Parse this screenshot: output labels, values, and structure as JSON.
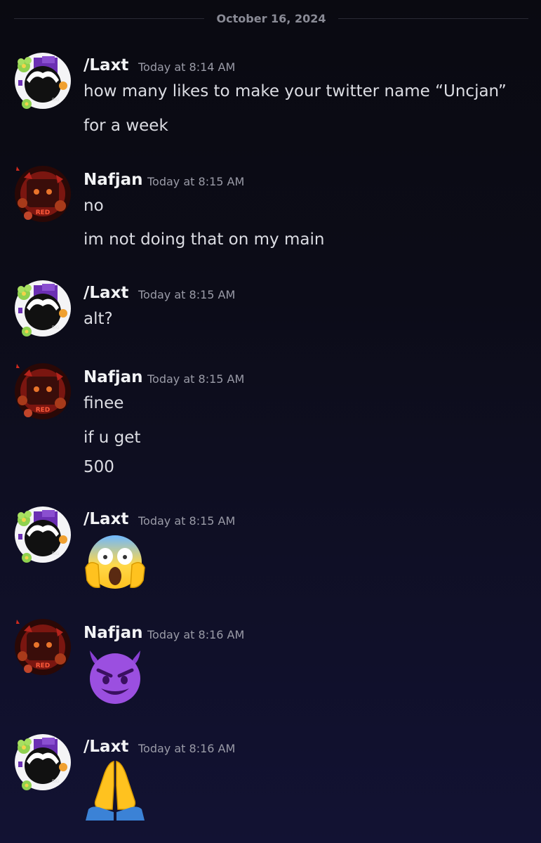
{
  "date_divider": "October 16, 2024",
  "messages": [
    {
      "author": "/Laxt",
      "time": "Today at 8:14 AM",
      "lines": [
        "how many likes to make your twitter name “Uncjan”",
        "for a week"
      ]
    },
    {
      "author": "Nafjan",
      "time": "Today at 8:15 AM",
      "lines": [
        "no",
        "im not doing that on my main"
      ]
    },
    {
      "author": "/Laxt",
      "time": "Today at 8:15 AM",
      "lines": [
        "alt?"
      ]
    },
    {
      "author": "Nafjan",
      "time": "Today at 8:15 AM",
      "lines": [
        "finee",
        "if u get",
        "500"
      ]
    },
    {
      "author": "/Laxt",
      "time": "Today at 8:15 AM",
      "emoji": "face-screaming-in-fear-emoji"
    },
    {
      "author": "Nafjan",
      "time": "Today at 8:16 AM",
      "emoji": "smiling-face-with-horns-emoji"
    },
    {
      "author": "/Laxt",
      "time": "Today at 8:16 AM",
      "emoji": "folded-hands-emoji"
    }
  ],
  "avatars": {
    "laxt": {
      "name": "laxt-avatar",
      "avatar_text": "BIG",
      "colors": [
        "#6b2fb3",
        "#8fd14f",
        "#111111"
      ]
    },
    "nafjan": {
      "name": "nafjan-avatar",
      "avatar_text": "RED",
      "colors": [
        "#b4231c",
        "#3a0d0a",
        "#e8742b"
      ]
    }
  },
  "theme": {
    "background_top": "#0a0a11",
    "background_bottom": "#121233",
    "username_color": "#f2f3f5",
    "timestamp_color": "#9a9ba7",
    "text_color": "#dcdde3"
  }
}
